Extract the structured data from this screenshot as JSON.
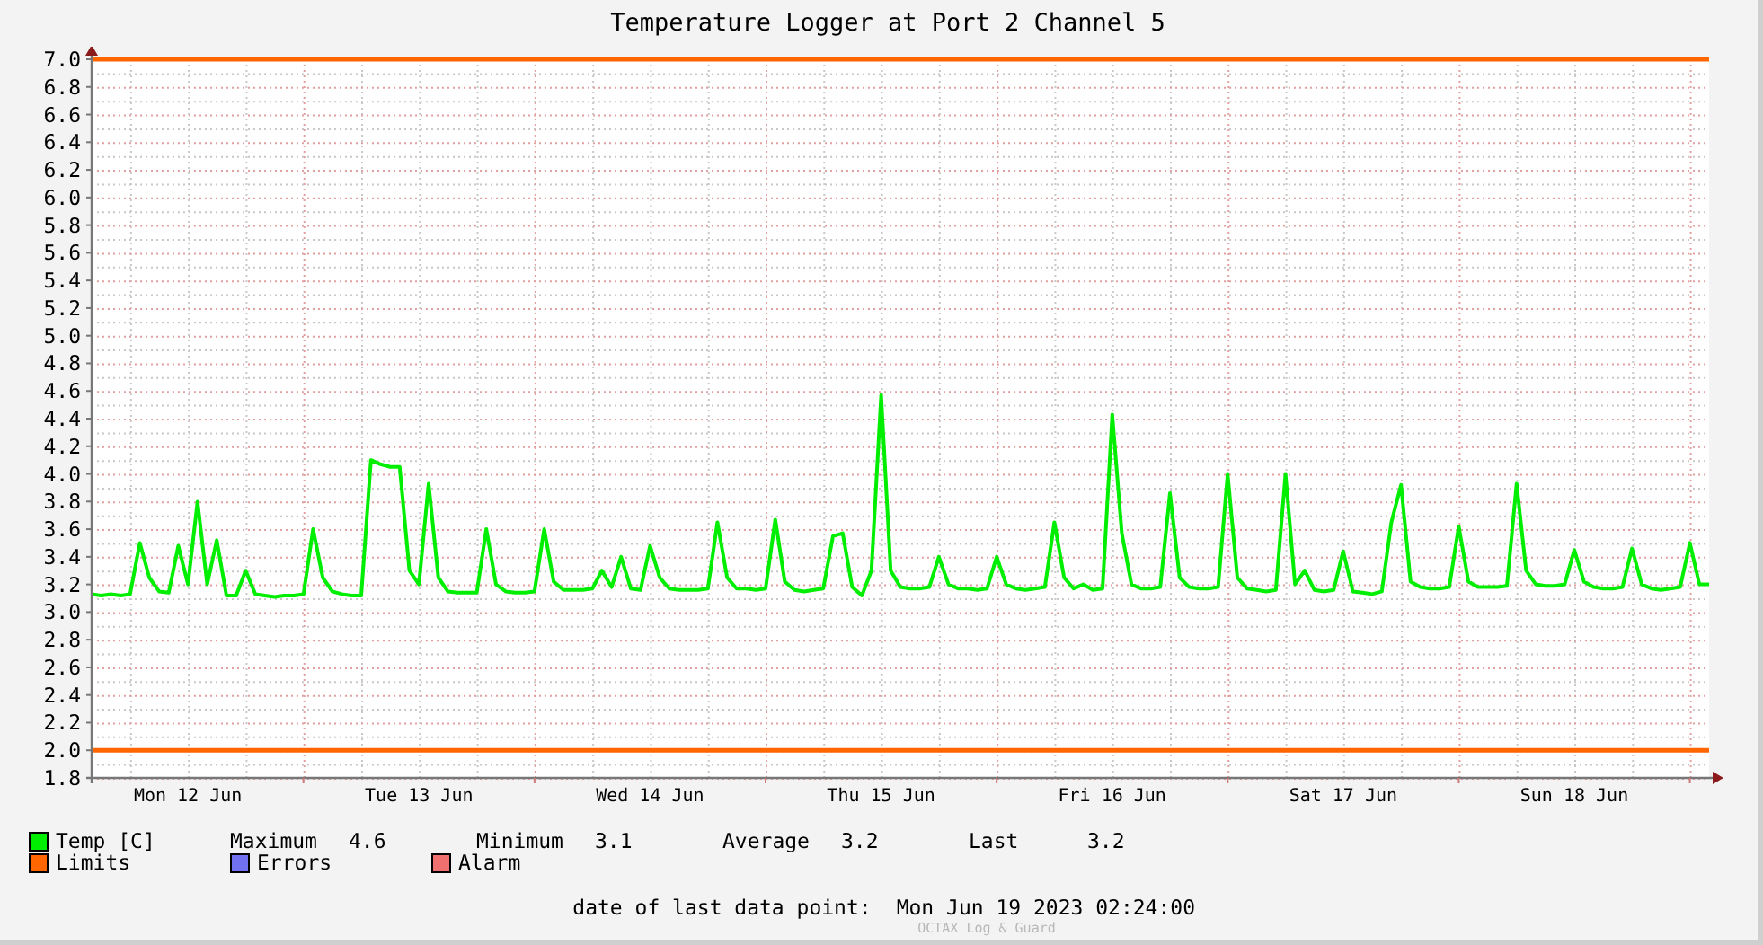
{
  "title": "Temperature Logger at Port 2 Channel 5",
  "chart_data": {
    "type": "line",
    "categories": [
      null,
      null,
      null,
      null,
      null,
      null,
      null,
      null,
      null,
      null,
      "Mon 12 Jun",
      null,
      null,
      null,
      null,
      null,
      null,
      null,
      null,
      null,
      null,
      null,
      null,
      null,
      null,
      null,
      null,
      null,
      null,
      null,
      null,
      null,
      null,
      null,
      "Tue 13 Jun",
      null,
      null,
      null,
      null,
      null,
      null,
      null,
      null,
      null,
      null,
      null,
      null,
      null,
      null,
      null,
      null,
      null,
      null,
      null,
      null,
      null,
      null,
      null,
      "Wed 14 Jun",
      null,
      null,
      null,
      null,
      null,
      null,
      null,
      null,
      null,
      null,
      null,
      null,
      null,
      null,
      null,
      null,
      null,
      null,
      null,
      null,
      null,
      null,
      null,
      "Thu 15 Jun",
      null,
      null,
      null,
      null,
      null,
      null,
      null,
      null,
      null,
      null,
      null,
      null,
      null,
      null,
      null,
      null,
      null,
      null,
      null,
      null,
      null,
      null,
      null,
      "Fri 16 Jun",
      null,
      null,
      null,
      null,
      null,
      null,
      null,
      null,
      null,
      null,
      null,
      null,
      null,
      null,
      null,
      null,
      null,
      null,
      null,
      null,
      null,
      null,
      null,
      "Sat 17 Jun",
      null,
      null,
      null,
      null,
      null,
      null,
      null,
      null,
      null,
      null,
      null,
      null,
      null,
      null,
      null,
      null,
      null,
      null,
      null,
      null,
      null,
      null,
      null,
      "Sun 18 Jun",
      null,
      null,
      null,
      null,
      null,
      null,
      null,
      null,
      null,
      null,
      null,
      null,
      null,
      null
    ],
    "series": [
      {
        "name": "Temp [C]",
        "color": "#00ee00",
        "values": [
          3.13,
          3.12,
          3.13,
          3.12,
          3.13,
          3.5,
          3.25,
          3.15,
          3.14,
          3.48,
          3.2,
          3.8,
          3.2,
          3.52,
          3.12,
          3.12,
          3.3,
          3.13,
          3.12,
          3.11,
          3.12,
          3.12,
          3.13,
          3.6,
          3.25,
          3.15,
          3.13,
          3.12,
          3.12,
          4.1,
          4.07,
          4.05,
          4.05,
          3.3,
          3.2,
          3.93,
          3.25,
          3.15,
          3.14,
          3.14,
          3.14,
          3.6,
          3.2,
          3.15,
          3.14,
          3.14,
          3.15,
          3.6,
          3.22,
          3.16,
          3.16,
          3.16,
          3.17,
          3.3,
          3.18,
          3.4,
          3.17,
          3.16,
          3.48,
          3.25,
          3.17,
          3.16,
          3.16,
          3.16,
          3.17,
          3.65,
          3.25,
          3.17,
          3.17,
          3.16,
          3.17,
          3.67,
          3.22,
          3.16,
          3.15,
          3.16,
          3.17,
          3.55,
          3.57,
          3.18,
          3.12,
          3.3,
          4.57,
          3.3,
          3.18,
          3.17,
          3.17,
          3.18,
          3.4,
          3.2,
          3.17,
          3.17,
          3.16,
          3.17,
          3.4,
          3.2,
          3.17,
          3.16,
          3.17,
          3.18,
          3.65,
          3.25,
          3.17,
          3.2,
          3.16,
          3.17,
          4.43,
          3.57,
          3.2,
          3.17,
          3.17,
          3.18,
          3.86,
          3.25,
          3.18,
          3.17,
          3.17,
          3.18,
          4.0,
          3.25,
          3.17,
          3.16,
          3.15,
          3.16,
          4.0,
          3.2,
          3.3,
          3.16,
          3.15,
          3.16,
          3.44,
          3.15,
          3.14,
          3.13,
          3.15,
          3.65,
          3.92,
          3.22,
          3.18,
          3.17,
          3.17,
          3.18,
          3.62,
          3.22,
          3.18,
          3.18,
          3.18,
          3.19,
          3.93,
          3.3,
          3.2,
          3.19,
          3.19,
          3.2,
          3.45,
          3.22,
          3.18,
          3.17,
          3.17,
          3.18,
          3.46,
          3.2,
          3.17,
          3.16,
          3.17,
          3.18,
          3.5,
          3.2,
          3.2
        ]
      }
    ],
    "ylim": [
      1.8,
      7.0
    ],
    "yticks": [
      {
        "value": 1.8,
        "label": "1.8"
      },
      {
        "value": 2.0,
        "label": "2.0"
      },
      {
        "value": 2.2,
        "label": "2.2"
      },
      {
        "value": 2.4,
        "label": "2.4"
      },
      {
        "value": 2.6,
        "label": "2.6"
      },
      {
        "value": 2.8,
        "label": "2.8"
      },
      {
        "value": 3.0,
        "label": "3.0"
      },
      {
        "value": 3.2,
        "label": "3.2"
      },
      {
        "value": 3.4,
        "label": "3.4"
      },
      {
        "value": 3.6,
        "label": "3.6"
      },
      {
        "value": 3.8,
        "label": "3.8"
      },
      {
        "value": 4.0,
        "label": "4.0"
      },
      {
        "value": 4.2,
        "label": "4.2"
      },
      {
        "value": 4.4,
        "label": "4.4"
      },
      {
        "value": 4.6,
        "label": "4.6"
      },
      {
        "value": 4.8,
        "label": "4.8"
      },
      {
        "value": 5.0,
        "label": "5.0"
      },
      {
        "value": 5.2,
        "label": "5.2"
      },
      {
        "value": 5.4,
        "label": "5.4"
      },
      {
        "value": 5.6,
        "label": "5.6"
      },
      {
        "value": 5.8,
        "label": "5.8"
      },
      {
        "value": 6.0,
        "label": "6.0"
      },
      {
        "value": 6.2,
        "label": "6.2"
      },
      {
        "value": 6.4,
        "label": "6.4"
      },
      {
        "value": 6.6,
        "label": "6.6"
      },
      {
        "value": 6.8,
        "label": "6.8"
      },
      {
        "value": 7.0,
        "label": "7.0"
      }
    ],
    "grid": true,
    "ref_lines": [
      {
        "axis": "y",
        "value": 7.0,
        "color": "#ff6600"
      },
      {
        "axis": "y",
        "value": 2.0,
        "color": "#ff6600"
      }
    ]
  },
  "legend": [
    [
      {
        "kind": "series",
        "stats": [
          {
            "label": "Maximum",
            "value": "4.6"
          },
          {
            "label": "Minimum",
            "value": "3.1"
          },
          {
            "label": "Average",
            "value": "3.2"
          },
          {
            "label": "Last",
            "value": "3.2"
          }
        ]
      }
    ],
    [
      {
        "kind": "plain",
        "label": "Limits",
        "color": "#ff6600"
      },
      {
        "kind": "plain",
        "label": "Errors",
        "color": "#7070f0"
      },
      {
        "kind": "plain",
        "label": "Alarm",
        "color": "#f07070"
      }
    ]
  ],
  "last_data_point": {
    "label": "date of last data point:",
    "value": "Mon Jun 19 2023 02:24:00"
  },
  "credit": "OCTAX Log & Guard"
}
